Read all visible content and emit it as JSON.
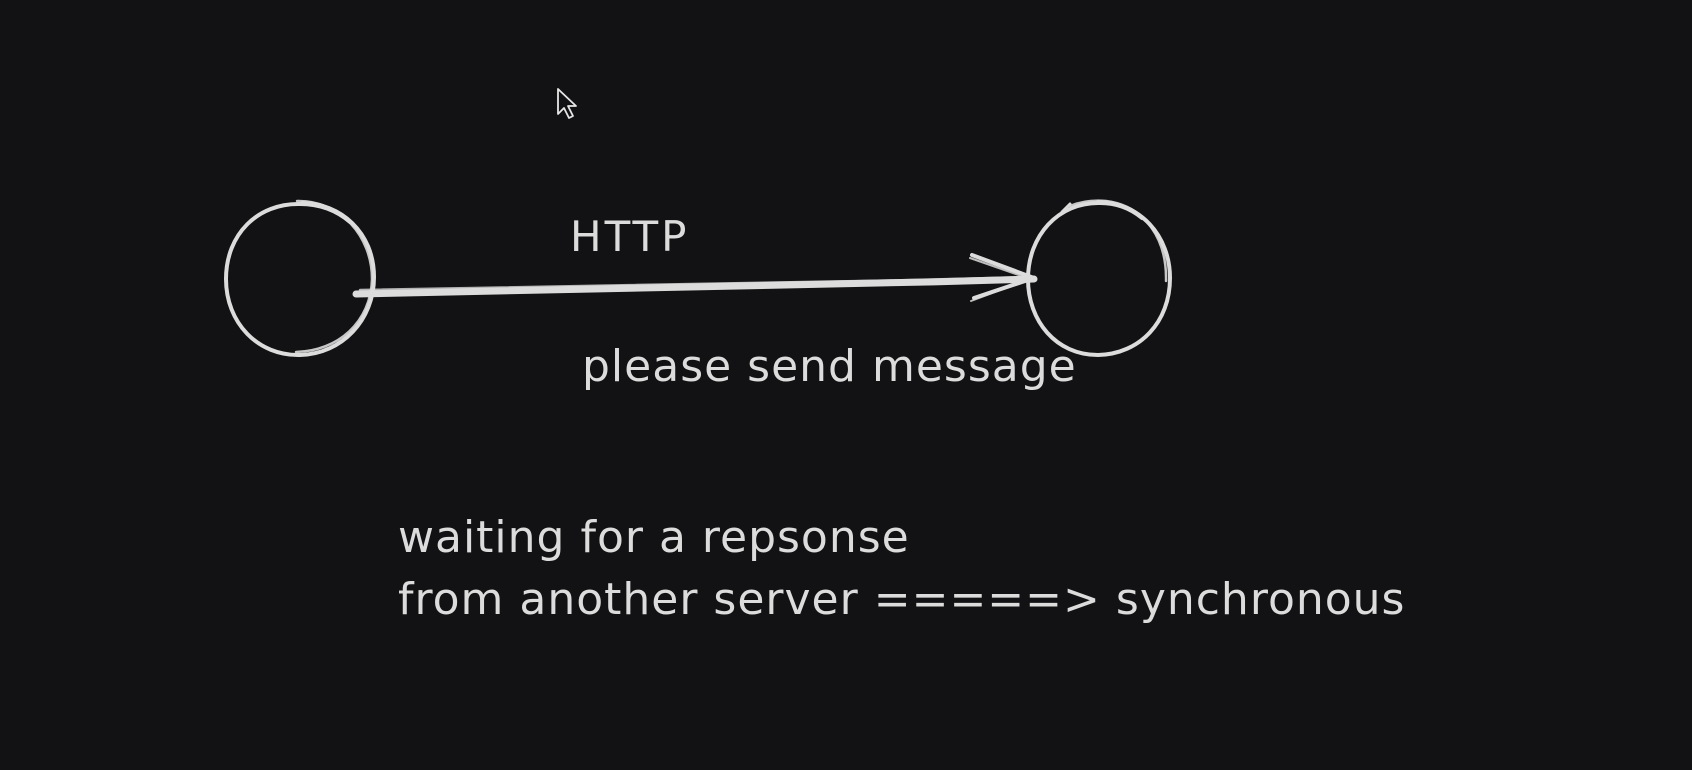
{
  "canvas": {
    "background_color": "#121214",
    "stroke_color": "#dcdcdc"
  },
  "diagram": {
    "nodes": [
      {
        "id": "client",
        "shape": "circle",
        "label": ""
      },
      {
        "id": "server",
        "shape": "circle",
        "label": ""
      }
    ],
    "edge": {
      "from": "client",
      "to": "server",
      "label_above": "HTTP",
      "label_below": "please send message"
    },
    "note": {
      "line1": "waiting for a repsonse",
      "line2": "from another server =====> synchronous"
    }
  },
  "cursor": {
    "icon": "mouse-pointer-icon"
  }
}
